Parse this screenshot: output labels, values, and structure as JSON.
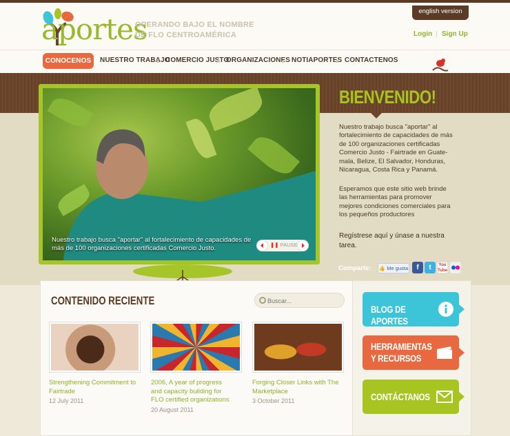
{
  "header": {
    "logo_text": "aportes",
    "tagline_line1": "OPERANDO BAJO EL NOMBRE",
    "tagline_line2": "DE FLO CENTROAMÉRICA",
    "english_version": "english version",
    "login": "Login",
    "signup": "Sign Up"
  },
  "nav": {
    "items": [
      {
        "label": "CONOCENOS"
      },
      {
        "label": "NUESTRO TRABAJO"
      },
      {
        "label": "COMERCIO JUSTO"
      },
      {
        "label": "ORGANIZACIONES"
      },
      {
        "label": "NOTIAPORTES"
      },
      {
        "label": "CONTACTENOS"
      }
    ]
  },
  "hero": {
    "caption": "Nuestro trabajo busca \"aportar\" al fortalecimiento de capacidades de más de 100 organizaciones certificadas Comercio Justo.",
    "pause_label": "PAUSE"
  },
  "welcome": {
    "title": "BIENVENIDO!",
    "p1": "Nuestro trabajo busca \"aportar\" al fortalecimiento de capacidades de más de 100 organizaciones certificadas Comercio Justo - Fairtrade  en Guate-mala, Belize, El Salvador, Honduras, Nicaragua, Costa Rica y Panamá.",
    "p2": "Esperamos que este sitio web brinde las herramientas para promover mejores condiciones comerciales para los pequeños productores",
    "p3": "Regístrese aquí y únase a nuestra tarea."
  },
  "share": {
    "label": "Comparte:",
    "like": "Me gusta",
    "icons": [
      "facebook-icon",
      "twitter-icon",
      "youtube-icon",
      "flickr-icon"
    ],
    "youtube_text": "You Tube"
  },
  "content": {
    "title": "CONTENIDO RECIENTE",
    "search_placeholder": "Buscar...",
    "items": [
      {
        "title": "Strengthening Commitment to Fairtrade",
        "date": "12 July 2011"
      },
      {
        "title": "2006, A year of progress and capacity building for FLO certified organizations",
        "date": "20 August 2011"
      },
      {
        "title": "Forging Closer Links with The Marketplace",
        "date": "3 October 2011"
      }
    ]
  },
  "sidebar": {
    "blog": "BLOG DE APORTES",
    "tools_line1": "HERRAMIENTAS",
    "tools_line2": "Y RECURSOS",
    "contact": "CONTÁCTANOS"
  },
  "colors": {
    "brand_green": "#a7c420",
    "brand_brown": "#5a3a24",
    "accent_orange": "#e8693f",
    "cyan": "#3cc4d8"
  }
}
